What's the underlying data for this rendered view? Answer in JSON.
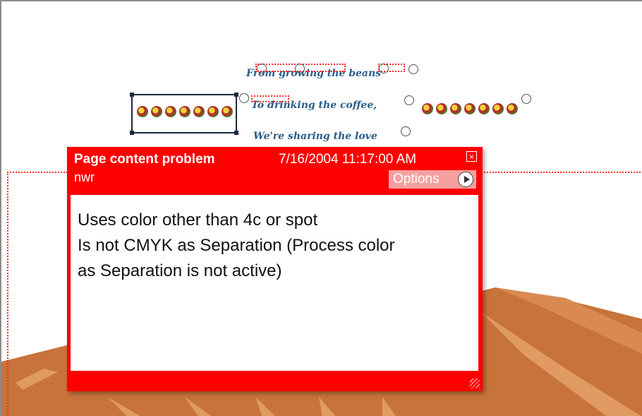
{
  "page": {
    "text_lines": [
      "From growing the beans",
      "To drinking the coffee,",
      "We're sharing the love"
    ]
  },
  "popup": {
    "title": "Page content problem",
    "datetime": "7/16/2004 11:17:00 AM",
    "author": "nwr",
    "options_label": "Options",
    "body_lines": [
      "Uses color other than 4c or spot",
      "Is not CMYK as Separation (Process color",
      "as Separation is not active)"
    ]
  },
  "colors": {
    "popup_red": "#ff0000",
    "text_blue": "#2a5d8c",
    "hill_brown": "#c8733a"
  },
  "icons": {
    "annotation_marker": "a-circle-icon",
    "close": "close-icon",
    "options_arrow": "play-arrow-icon"
  }
}
